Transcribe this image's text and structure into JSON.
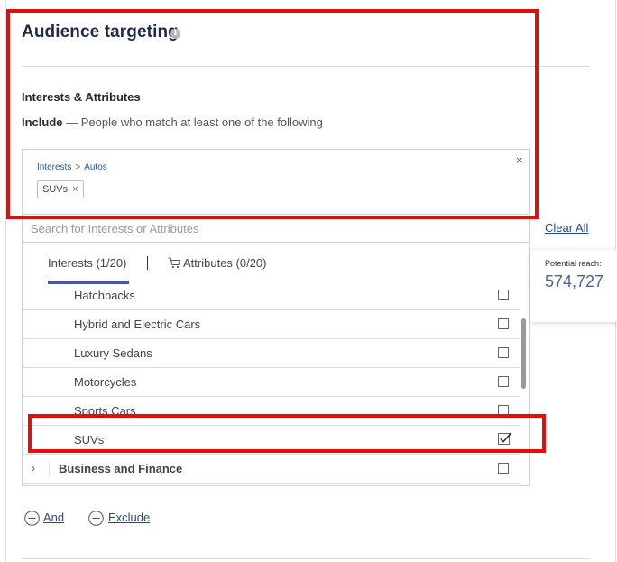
{
  "header": {
    "title": "Audience targeting",
    "info_glyph": "i"
  },
  "interests_section": {
    "label": "Interests & Attributes",
    "include_bold": "Include",
    "include_text": " — People who match at least one of the following"
  },
  "selected": {
    "breadcrumb": [
      "Interests",
      "Autos"
    ],
    "breadcrumb_sep": ">",
    "remove_glyph": "×",
    "chips": [
      {
        "label": "SUVs",
        "remove_glyph": "×"
      }
    ]
  },
  "search": {
    "placeholder": "Search for Interests or Attributes",
    "value": ""
  },
  "clear_all_label": "Clear All",
  "tabs": [
    {
      "label": "Interests (1/20)",
      "active": true
    },
    {
      "label": "Attributes (0/20)",
      "active": false,
      "icon": "cart-icon"
    }
  ],
  "list": {
    "items": [
      {
        "label": "Hatchbacks",
        "checked": false
      },
      {
        "label": "Hybrid and Electric Cars",
        "checked": false
      },
      {
        "label": "Luxury Sedans",
        "checked": false
      },
      {
        "label": "Motorcycles",
        "checked": false
      },
      {
        "label": "Sports Cars",
        "checked": false
      },
      {
        "label": "SUVs",
        "checked": true
      },
      {
        "label": "Business and Finance",
        "checked": false,
        "category": true,
        "icon": "chevron-right-icon"
      }
    ]
  },
  "potential_reach": {
    "label": "Potential reach:",
    "value": "574,727"
  },
  "actions": {
    "and_label": "And",
    "exclude_label": "Exclude"
  },
  "colors": {
    "accent": "#4a57a6",
    "link": "#2d4a7a",
    "highlight": "#e20d0d",
    "reach_value": "#4a63a4"
  }
}
